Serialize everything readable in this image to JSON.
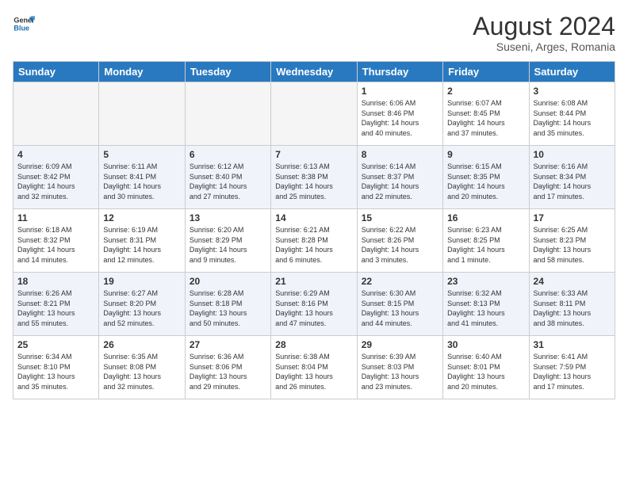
{
  "header": {
    "logo": {
      "line1": "General",
      "line2": "Blue"
    },
    "title": "August 2024",
    "location": "Suseni, Arges, Romania"
  },
  "weekdays": [
    "Sunday",
    "Monday",
    "Tuesday",
    "Wednesday",
    "Thursday",
    "Friday",
    "Saturday"
  ],
  "weeks": [
    [
      {
        "day": "",
        "info": ""
      },
      {
        "day": "",
        "info": ""
      },
      {
        "day": "",
        "info": ""
      },
      {
        "day": "",
        "info": ""
      },
      {
        "day": "1",
        "info": "Sunrise: 6:06 AM\nSunset: 8:46 PM\nDaylight: 14 hours\nand 40 minutes."
      },
      {
        "day": "2",
        "info": "Sunrise: 6:07 AM\nSunset: 8:45 PM\nDaylight: 14 hours\nand 37 minutes."
      },
      {
        "day": "3",
        "info": "Sunrise: 6:08 AM\nSunset: 8:44 PM\nDaylight: 14 hours\nand 35 minutes."
      }
    ],
    [
      {
        "day": "4",
        "info": "Sunrise: 6:09 AM\nSunset: 8:42 PM\nDaylight: 14 hours\nand 32 minutes."
      },
      {
        "day": "5",
        "info": "Sunrise: 6:11 AM\nSunset: 8:41 PM\nDaylight: 14 hours\nand 30 minutes."
      },
      {
        "day": "6",
        "info": "Sunrise: 6:12 AM\nSunset: 8:40 PM\nDaylight: 14 hours\nand 27 minutes."
      },
      {
        "day": "7",
        "info": "Sunrise: 6:13 AM\nSunset: 8:38 PM\nDaylight: 14 hours\nand 25 minutes."
      },
      {
        "day": "8",
        "info": "Sunrise: 6:14 AM\nSunset: 8:37 PM\nDaylight: 14 hours\nand 22 minutes."
      },
      {
        "day": "9",
        "info": "Sunrise: 6:15 AM\nSunset: 8:35 PM\nDaylight: 14 hours\nand 20 minutes."
      },
      {
        "day": "10",
        "info": "Sunrise: 6:16 AM\nSunset: 8:34 PM\nDaylight: 14 hours\nand 17 minutes."
      }
    ],
    [
      {
        "day": "11",
        "info": "Sunrise: 6:18 AM\nSunset: 8:32 PM\nDaylight: 14 hours\nand 14 minutes."
      },
      {
        "day": "12",
        "info": "Sunrise: 6:19 AM\nSunset: 8:31 PM\nDaylight: 14 hours\nand 12 minutes."
      },
      {
        "day": "13",
        "info": "Sunrise: 6:20 AM\nSunset: 8:29 PM\nDaylight: 14 hours\nand 9 minutes."
      },
      {
        "day": "14",
        "info": "Sunrise: 6:21 AM\nSunset: 8:28 PM\nDaylight: 14 hours\nand 6 minutes."
      },
      {
        "day": "15",
        "info": "Sunrise: 6:22 AM\nSunset: 8:26 PM\nDaylight: 14 hours\nand 3 minutes."
      },
      {
        "day": "16",
        "info": "Sunrise: 6:23 AM\nSunset: 8:25 PM\nDaylight: 14 hours\nand 1 minute."
      },
      {
        "day": "17",
        "info": "Sunrise: 6:25 AM\nSunset: 8:23 PM\nDaylight: 13 hours\nand 58 minutes."
      }
    ],
    [
      {
        "day": "18",
        "info": "Sunrise: 6:26 AM\nSunset: 8:21 PM\nDaylight: 13 hours\nand 55 minutes."
      },
      {
        "day": "19",
        "info": "Sunrise: 6:27 AM\nSunset: 8:20 PM\nDaylight: 13 hours\nand 52 minutes."
      },
      {
        "day": "20",
        "info": "Sunrise: 6:28 AM\nSunset: 8:18 PM\nDaylight: 13 hours\nand 50 minutes."
      },
      {
        "day": "21",
        "info": "Sunrise: 6:29 AM\nSunset: 8:16 PM\nDaylight: 13 hours\nand 47 minutes."
      },
      {
        "day": "22",
        "info": "Sunrise: 6:30 AM\nSunset: 8:15 PM\nDaylight: 13 hours\nand 44 minutes."
      },
      {
        "day": "23",
        "info": "Sunrise: 6:32 AM\nSunset: 8:13 PM\nDaylight: 13 hours\nand 41 minutes."
      },
      {
        "day": "24",
        "info": "Sunrise: 6:33 AM\nSunset: 8:11 PM\nDaylight: 13 hours\nand 38 minutes."
      }
    ],
    [
      {
        "day": "25",
        "info": "Sunrise: 6:34 AM\nSunset: 8:10 PM\nDaylight: 13 hours\nand 35 minutes."
      },
      {
        "day": "26",
        "info": "Sunrise: 6:35 AM\nSunset: 8:08 PM\nDaylight: 13 hours\nand 32 minutes."
      },
      {
        "day": "27",
        "info": "Sunrise: 6:36 AM\nSunset: 8:06 PM\nDaylight: 13 hours\nand 29 minutes."
      },
      {
        "day": "28",
        "info": "Sunrise: 6:38 AM\nSunset: 8:04 PM\nDaylight: 13 hours\nand 26 minutes."
      },
      {
        "day": "29",
        "info": "Sunrise: 6:39 AM\nSunset: 8:03 PM\nDaylight: 13 hours\nand 23 minutes."
      },
      {
        "day": "30",
        "info": "Sunrise: 6:40 AM\nSunset: 8:01 PM\nDaylight: 13 hours\nand 20 minutes."
      },
      {
        "day": "31",
        "info": "Sunrise: 6:41 AM\nSunset: 7:59 PM\nDaylight: 13 hours\nand 17 minutes."
      }
    ]
  ]
}
